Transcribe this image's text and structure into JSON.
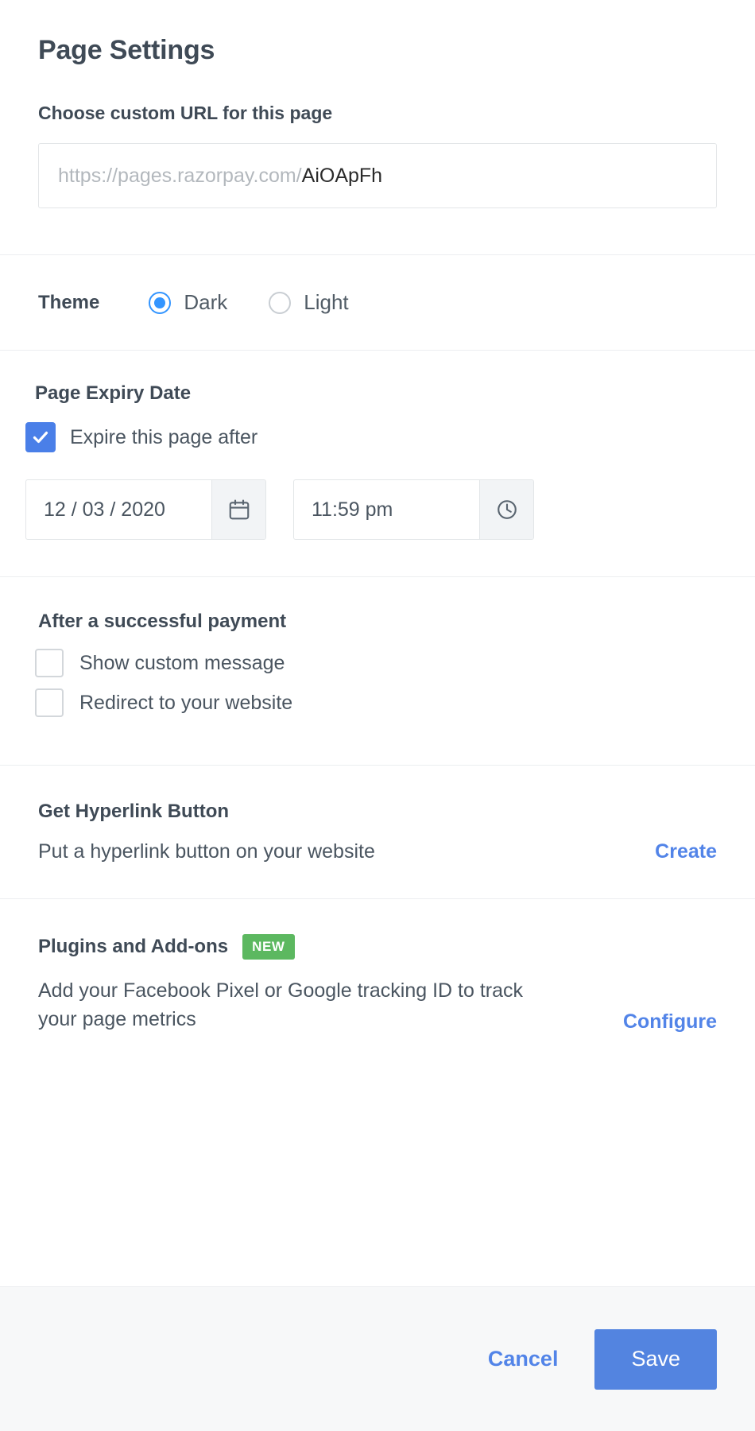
{
  "header": {
    "title": "Page Settings"
  },
  "url": {
    "label": "Choose custom URL for this page",
    "prefix": "https://pages.razorpay.com/",
    "value": "AiOApFh"
  },
  "theme": {
    "label": "Theme",
    "options": [
      {
        "label": "Dark",
        "selected": true
      },
      {
        "label": "Light",
        "selected": false
      }
    ]
  },
  "expiry": {
    "title": "Page Expiry Date",
    "checkbox_label": "Expire this page after",
    "checked": true,
    "date_value": "12 / 03 / 2020",
    "time_value": "11:59 pm",
    "calendar_icon": "calendar-icon",
    "clock_icon": "clock-icon"
  },
  "after_payment": {
    "title": "After a successful payment",
    "options": [
      {
        "label": "Show custom message",
        "checked": false
      },
      {
        "label": "Redirect to your website",
        "checked": false
      }
    ]
  },
  "hyperlink": {
    "title": "Get Hyperlink Button",
    "description": "Put a hyperlink button on your website",
    "action": "Create"
  },
  "plugins": {
    "title": "Plugins and Add-ons",
    "badge": "NEW",
    "description": "Add your Facebook Pixel or Google tracking ID to track your page metrics",
    "action": "Configure"
  },
  "footer": {
    "cancel_label": "Cancel",
    "save_label": "Save"
  },
  "colors": {
    "accent_blue": "#5384e0",
    "link_blue": "#5284e8",
    "radio_blue": "#3395ff",
    "badge_green": "#5cb860",
    "text_dark": "#3f4a56"
  }
}
